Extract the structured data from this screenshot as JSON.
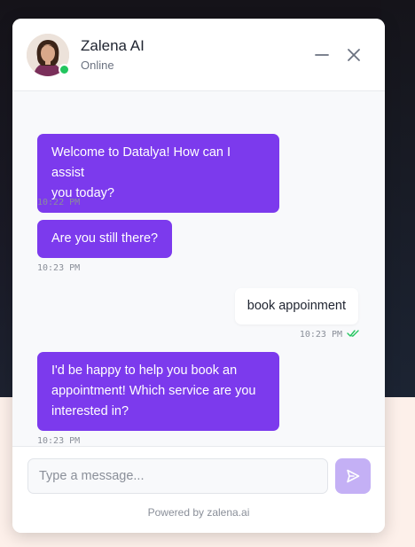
{
  "header": {
    "agent_name": "Zalena AI",
    "agent_status": "Online",
    "status_color": "#22c55e",
    "minimize_icon": "minimize-icon",
    "close_icon": "close-icon"
  },
  "messages": [
    {
      "sender": "bot",
      "line1": "Welcome to Datalya! How can I assist",
      "line2": "you today?",
      "time": "10:22 PM"
    },
    {
      "sender": "bot",
      "line1": "Are you still there?",
      "time": "10:23 PM"
    },
    {
      "sender": "user",
      "line1": "book appoinment",
      "time": "10:23 PM",
      "read_receipt": "double-check-icon"
    },
    {
      "sender": "bot",
      "line1": "I'd be happy to help you book an",
      "line2": "appointment! Which service are you",
      "line3": "interested in?",
      "time": "10:23 PM"
    }
  ],
  "composer": {
    "placeholder": "Type a message...",
    "send_icon": "send-icon"
  },
  "footer": {
    "text": "Powered by zalena.ai"
  },
  "colors": {
    "bot_bubble": "#7c3aed",
    "send_button": "#c4b0f5",
    "read_receipt": "#22c55e"
  }
}
